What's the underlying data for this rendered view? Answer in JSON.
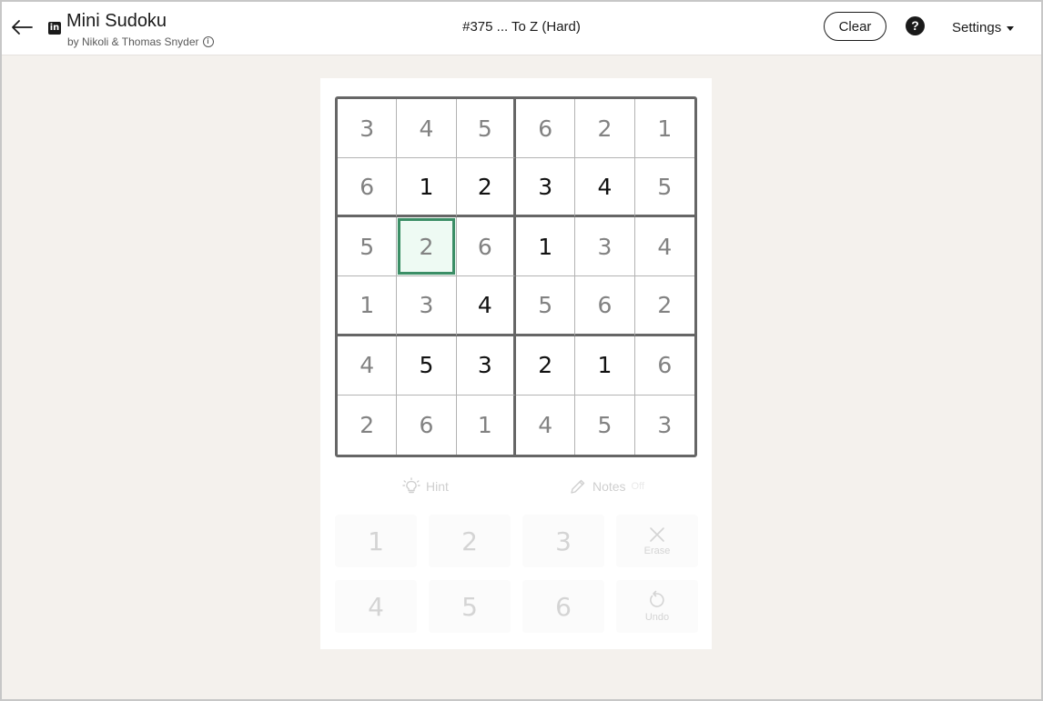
{
  "header": {
    "title": "Mini Sudoku",
    "byline": "by Nikoli & Thomas Snyder",
    "logo_text": "in",
    "puzzle_title": "#375 ... To Z (Hard)",
    "clear_label": "Clear",
    "help_label": "?",
    "settings_label": "Settings",
    "info_label": "i"
  },
  "board": {
    "size": 6,
    "selected_cell": {
      "row": 2,
      "col": 1
    },
    "rows": [
      [
        {
          "v": "3",
          "t": "given"
        },
        {
          "v": "4",
          "t": "given"
        },
        {
          "v": "5",
          "t": "given"
        },
        {
          "v": "6",
          "t": "given"
        },
        {
          "v": "2",
          "t": "given"
        },
        {
          "v": "1",
          "t": "given"
        }
      ],
      [
        {
          "v": "6",
          "t": "given"
        },
        {
          "v": "1",
          "t": "entered"
        },
        {
          "v": "2",
          "t": "entered"
        },
        {
          "v": "3",
          "t": "entered"
        },
        {
          "v": "4",
          "t": "entered"
        },
        {
          "v": "5",
          "t": "given"
        }
      ],
      [
        {
          "v": "5",
          "t": "given"
        },
        {
          "v": "2",
          "t": "given"
        },
        {
          "v": "6",
          "t": "given"
        },
        {
          "v": "1",
          "t": "entered"
        },
        {
          "v": "3",
          "t": "given"
        },
        {
          "v": "4",
          "t": "given"
        }
      ],
      [
        {
          "v": "1",
          "t": "given"
        },
        {
          "v": "3",
          "t": "given"
        },
        {
          "v": "4",
          "t": "entered"
        },
        {
          "v": "5",
          "t": "given"
        },
        {
          "v": "6",
          "t": "given"
        },
        {
          "v": "2",
          "t": "given"
        }
      ],
      [
        {
          "v": "4",
          "t": "given"
        },
        {
          "v": "5",
          "t": "entered"
        },
        {
          "v": "3",
          "t": "entered"
        },
        {
          "v": "2",
          "t": "entered"
        },
        {
          "v": "1",
          "t": "entered"
        },
        {
          "v": "6",
          "t": "given"
        }
      ],
      [
        {
          "v": "2",
          "t": "given"
        },
        {
          "v": "6",
          "t": "given"
        },
        {
          "v": "1",
          "t": "given"
        },
        {
          "v": "4",
          "t": "given"
        },
        {
          "v": "5",
          "t": "given"
        },
        {
          "v": "3",
          "t": "given"
        }
      ]
    ]
  },
  "tools": {
    "hint_label": "Hint",
    "notes_label": "Notes",
    "notes_state": "Off"
  },
  "keypad": {
    "keys_row1": [
      "1",
      "2",
      "3"
    ],
    "keys_row2": [
      "4",
      "5",
      "6"
    ],
    "erase_label": "Erase",
    "undo_label": "Undo"
  },
  "colors": {
    "accent": "#3b8e66",
    "selected_bg": "#eefaf3",
    "given_digit": "#828282",
    "entered_digit": "#111111",
    "page_bg": "#f4f1ed"
  }
}
